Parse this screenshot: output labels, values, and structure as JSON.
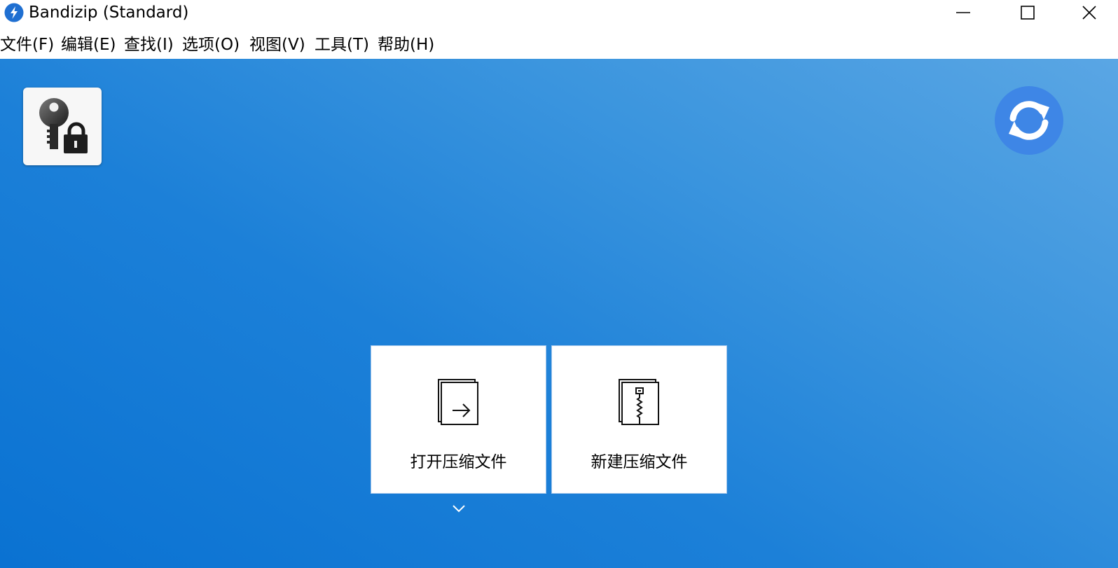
{
  "window": {
    "title": "Bandizip (Standard)",
    "icon": "bandizip-logo-icon",
    "controls": [
      "minimize-icon",
      "maximize-icon",
      "close-icon"
    ]
  },
  "menu": {
    "items": [
      {
        "label": "文件(F)"
      },
      {
        "label": "编辑(E)"
      },
      {
        "label": "查找(I)"
      },
      {
        "label": "选项(O)"
      },
      {
        "label": "视图(V)"
      },
      {
        "label": "工具(T)"
      },
      {
        "label": "帮助(H)"
      }
    ]
  },
  "main": {
    "password_tool_icon": "key-lock-icon",
    "refresh_icon": "refresh-icon",
    "actions": [
      {
        "label": "打开压缩文件",
        "icon": "open-archive-icon"
      },
      {
        "label": "新建压缩文件",
        "icon": "new-archive-icon"
      }
    ],
    "more_icon": "chevron-down-icon"
  },
  "colors": {
    "content_gradient_start": "#5aa6e4",
    "content_gradient_end": "#0a72d2",
    "refresh_button": "#3e86e6",
    "app_icon": "#1f6fd1"
  }
}
